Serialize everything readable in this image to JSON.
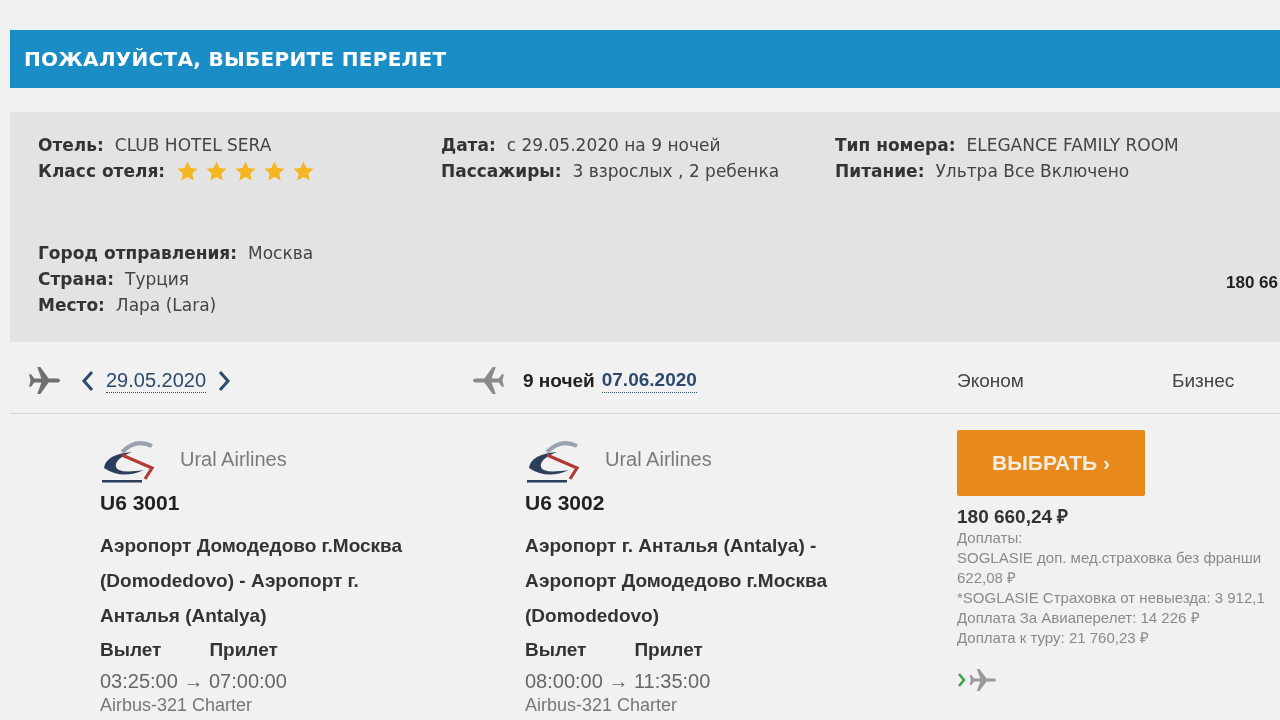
{
  "header": {
    "title": "ПОЖАЛУЙСТА, ВЫБЕРИТЕ ПЕРЕЛЕТ"
  },
  "summary": {
    "columns": [
      [
        {
          "kind": "text",
          "label": "Отель:",
          "value": "CLUB HOTEL SERA"
        },
        {
          "kind": "stars",
          "label": "Класс отеля:",
          "stars": 5
        }
      ],
      [
        {
          "kind": "text",
          "label": "Дата:",
          "value": "с 29.05.2020 на 9 ночей"
        },
        {
          "kind": "text",
          "label": "Пассажиры:",
          "value": "3 взрослых , 2 ребенка"
        }
      ],
      [
        {
          "kind": "text",
          "label": "Тип номера:",
          "value": "ELEGANCE FAMILY ROOM"
        },
        {
          "kind": "text",
          "label": "Питание:",
          "value": "Ультра Все Включено"
        }
      ]
    ],
    "location": [
      {
        "label": "Город отправления:",
        "value": "Москва"
      },
      {
        "label": "Страна:",
        "value": "Турция"
      },
      {
        "label": "Место:",
        "value": "Лара (Lara)"
      }
    ],
    "total": "180 66"
  },
  "date_bar": {
    "outbound": {
      "date": "29.05.2020"
    },
    "return": {
      "nights": "9 ночей",
      "date": "07.06.2020"
    },
    "fare_classes": [
      "Эконом",
      "Бизнес"
    ]
  },
  "flights": [
    {
      "airline": "Ural Airlines",
      "number": "U6 3001",
      "route": "Аэропорт Домодедово г.Москва (Domodedovo) - Аэропорт г. Анталья (Antalya)",
      "departure_label": "Вылет",
      "arrival_label": "Прилет",
      "times": "03:25:00 → 07:00:00",
      "aircraft": "Airbus-321 Charter"
    },
    {
      "airline": "Ural Airlines",
      "number": "U6 3002",
      "route": "Аэропорт г. Анталья (Antalya) - Аэропорт Домодедово г.Москва (Domodedovo)",
      "departure_label": "Вылет",
      "arrival_label": "Прилет",
      "times": "08:00:00 → 11:35:00",
      "aircraft": "Airbus-321 Charter"
    }
  ],
  "offer": {
    "button": "ВЫБРАТЬ ›",
    "price": "180 660,24 ₽",
    "surcharges_label": "Доплаты:",
    "surcharges": [
      "SOGLASIE доп. мед.страховка без франши",
      "622,08 ₽",
      "*SOGLASIE Страховка от невыезда: 3 912,1",
      "Доплата За Авиаперелет: 14 226 ₽",
      "Доплата к туру: 21 760,23 ₽"
    ]
  }
}
